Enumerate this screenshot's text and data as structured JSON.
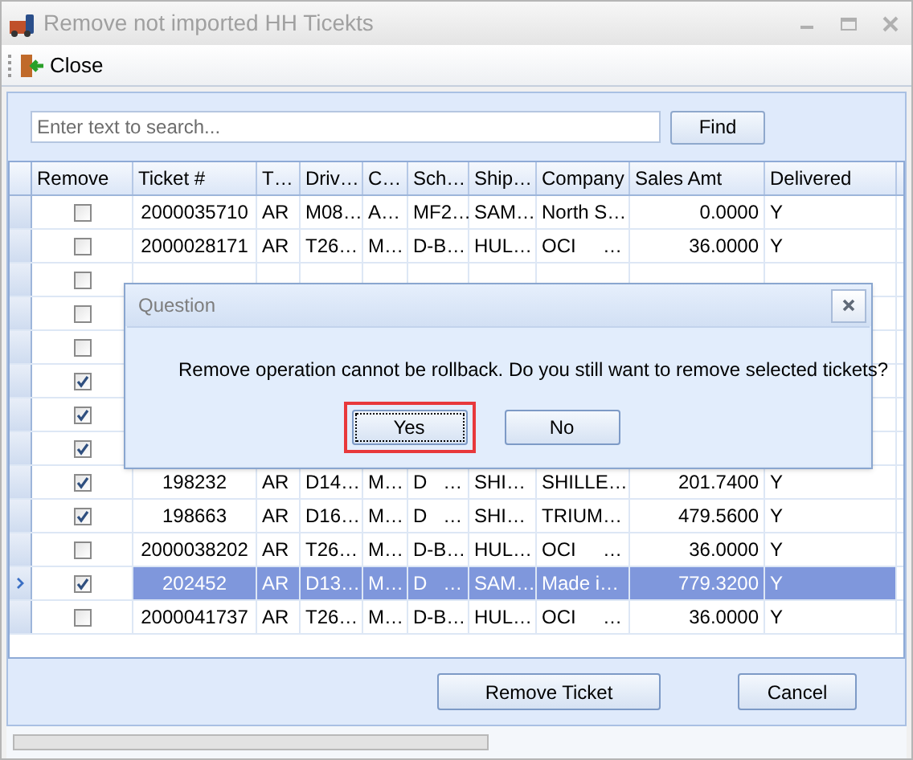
{
  "window": {
    "title": "Remove not imported HH Ticekts"
  },
  "toolbar": {
    "close_label": "Close"
  },
  "search": {
    "placeholder": "Enter text to search...",
    "button": "Find"
  },
  "table": {
    "columns": [
      "Remove",
      "Ticket #",
      "T…",
      "Driv…",
      "C…",
      "Sch…",
      "Ship…",
      "Company",
      "Sales Amt",
      "Delivered"
    ],
    "rows": [
      {
        "checked": false,
        "selected": false,
        "cells": [
          "2000035710",
          "AR",
          "M08…",
          "A…",
          "MF2…",
          "SAM…",
          "North S…",
          "0.0000",
          "Y"
        ]
      },
      {
        "checked": false,
        "selected": false,
        "cells": [
          "2000028171",
          "AR",
          "T26…",
          "M…",
          "D-B…",
          "HUL…",
          "OCI     …",
          "36.0000",
          "Y"
        ]
      },
      {
        "checked": false,
        "selected": false
      },
      {
        "checked": false,
        "selected": false
      },
      {
        "checked": false,
        "selected": false
      },
      {
        "checked": true,
        "selected": false
      },
      {
        "checked": true,
        "selected": false
      },
      {
        "checked": true,
        "selected": false
      },
      {
        "checked": true,
        "selected": false,
        "cells": [
          "198232",
          "AR",
          "D14…",
          "M…",
          "D   …",
          "SHI…",
          "SHILLE…",
          "201.7400",
          "Y"
        ]
      },
      {
        "checked": true,
        "selected": false,
        "cells": [
          "198663",
          "AR",
          "D16…",
          "M…",
          "D   …",
          "SHI…",
          "TRIUM…",
          "479.5600",
          "Y"
        ]
      },
      {
        "checked": false,
        "selected": false,
        "cells": [
          "2000038202",
          "AR",
          "T26…",
          "M…",
          "D-B…",
          "HUL…",
          "OCI     …",
          "36.0000",
          "Y"
        ]
      },
      {
        "checked": true,
        "selected": true,
        "cells": [
          "202452",
          "AR",
          "D13…",
          "M…",
          "D   …",
          "SAM…",
          "Made i…",
          "779.3200",
          "Y"
        ]
      },
      {
        "checked": false,
        "selected": false,
        "cells": [
          "2000041737",
          "AR",
          "T26…",
          "M…",
          "D-B…",
          "HUL…",
          "OCI     …",
          "36.0000",
          "Y"
        ]
      }
    ]
  },
  "buttons": [
    "Remove Ticket",
    "Cancel"
  ],
  "dialog": {
    "title": "Question",
    "message": "Remove operation cannot be rollback. Do you still want to remove selected tickets?",
    "buttons": [
      {
        "label": "Yes",
        "focused": true
      },
      {
        "label": "No",
        "focused": false
      }
    ]
  }
}
